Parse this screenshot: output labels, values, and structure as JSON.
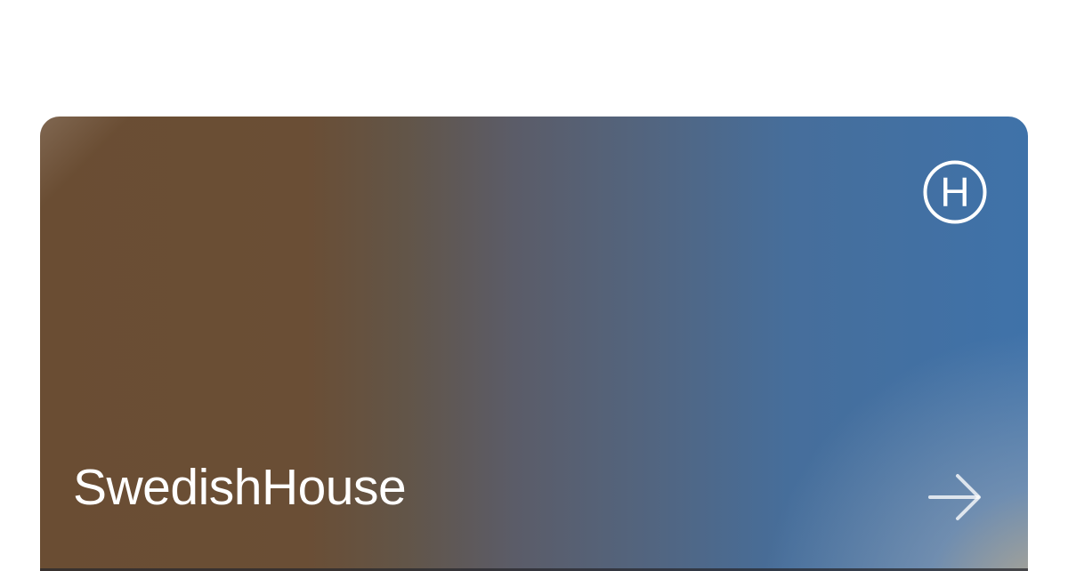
{
  "card": {
    "title": "SwedishHouse",
    "logo_icon": "circled-h-logo-icon",
    "logo_letter": "H",
    "arrow_icon": "arrow-right-icon",
    "colors": {
      "gradient_left": "#6a4d33",
      "gradient_right": "#3f72a9",
      "glow": "#d7be8c",
      "text": "#ffffff"
    }
  }
}
